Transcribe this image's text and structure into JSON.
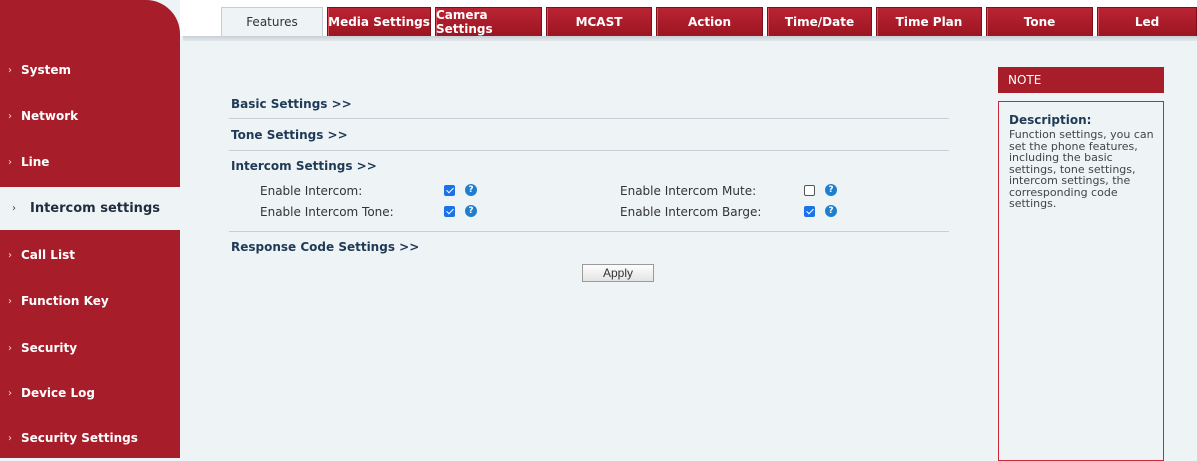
{
  "sidebar": {
    "items": [
      {
        "label": "System"
      },
      {
        "label": "Network"
      },
      {
        "label": "Line"
      },
      {
        "label": "Intercom settings"
      },
      {
        "label": "Call List"
      },
      {
        "label": "Function Key"
      },
      {
        "label": "Security"
      },
      {
        "label": "Device Log"
      },
      {
        "label": "Security Settings"
      }
    ],
    "active_index": 3
  },
  "tabs": [
    {
      "label": "Features"
    },
    {
      "label": "Media Settings"
    },
    {
      "label": "Camera Settings"
    },
    {
      "label": "MCAST"
    },
    {
      "label": "Action"
    },
    {
      "label": "Time/Date"
    },
    {
      "label": "Time Plan"
    },
    {
      "label": "Tone"
    },
    {
      "label": "Led"
    }
  ],
  "active_tab": "Features",
  "sections": {
    "basic": "Basic Settings >>",
    "tone": "Tone Settings >>",
    "intercom": "Intercom Settings >>",
    "response": "Response Code Settings >>"
  },
  "intercom_fields": {
    "enable_intercom": {
      "label": "Enable Intercom:",
      "checked": true
    },
    "enable_intercom_tone": {
      "label": "Enable Intercom Tone:",
      "checked": true
    },
    "enable_intercom_mute": {
      "label": "Enable Intercom Mute:",
      "checked": false
    },
    "enable_intercom_barge": {
      "label": "Enable Intercom Barge:",
      "checked": true
    }
  },
  "help_glyph": "?",
  "apply_label": "Apply",
  "note": {
    "header": "NOTE",
    "desc_title": "Description:",
    "desc_text": "Function settings, you can set the phone features, including the basic settings, tone settings, intercom settings, the corresponding code settings."
  },
  "colors": {
    "brand_red": "#a81d2a",
    "checkbox_blue": "#1a73e8",
    "help_blue": "#1e7fd0",
    "background": "#eef3f6"
  }
}
